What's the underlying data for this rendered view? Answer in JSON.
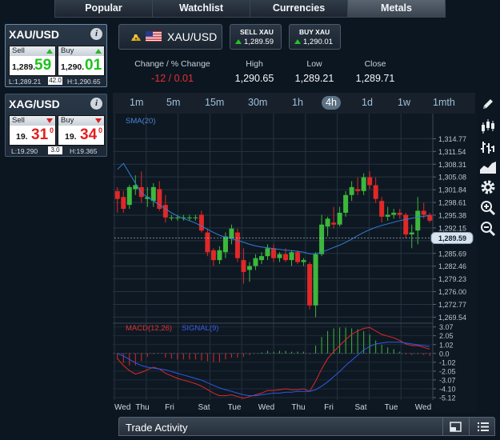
{
  "tabs": [
    "Popular",
    "Watchlist",
    "Currencies",
    "Metals"
  ],
  "active_tab": "Metals",
  "instruments": [
    {
      "name": "XAU/USD",
      "sell_label": "Sell",
      "buy_label": "Buy",
      "sell_small": "1,289.",
      "sell_big": "59",
      "sell_sup": "",
      "buy_small": "1,290.",
      "buy_big": "01",
      "buy_sup": "",
      "low": "L:1,289.21",
      "spread": "42.0",
      "high": "H:1,290.65",
      "direction": "up"
    },
    {
      "name": "XAG/USD",
      "sell_label": "Sell",
      "buy_label": "Buy",
      "sell_small": "19.",
      "sell_big": "31",
      "sell_sup": "0",
      "buy_small": "19.",
      "buy_big": "34",
      "buy_sup": "0",
      "low": "L:19.290",
      "spread": "3.0",
      "high": "H:19.365",
      "direction": "down"
    }
  ],
  "header": {
    "symbol": "XAU/USD",
    "sell_btn": {
      "title": "SELL XAU",
      "price": "1,289.59"
    },
    "buy_btn": {
      "title": "BUY XAU",
      "price": "1,290.01"
    },
    "stats": [
      {
        "label": "Change / % Change",
        "value": "-12 / 0.01",
        "color": "#e53030"
      },
      {
        "label": "High",
        "value": "1,290.65"
      },
      {
        "label": "Low",
        "value": "1,289.21"
      },
      {
        "label": "Close",
        "value": "1,289.71"
      }
    ]
  },
  "timeframes": [
    "1m",
    "5m",
    "15m",
    "30m",
    "1h",
    "4h",
    "1d",
    "1w",
    "1mth"
  ],
  "active_timeframe": "4h",
  "tools": [
    "pencil-icon",
    "candlestick-icon",
    "ohlc-bars-icon",
    "area-chart-icon",
    "settings-gear-icon",
    "zoom-in-icon",
    "zoom-out-icon"
  ],
  "trade_activity": {
    "title": "Trade Activity"
  },
  "chart_data": {
    "type": "candlestick",
    "indicator_label": "SMA(20)",
    "price_ticks": [
      "1,314.77",
      "1,311.54",
      "1,308.31",
      "1,305.08",
      "1,301.84",
      "1,298.61",
      "1,295.38",
      "1,292.15",
      "1,288.92",
      "1,285.69",
      "1,282.46",
      "1,279.23",
      "1,276.00",
      "1,272.77",
      "1,269.54"
    ],
    "price_range": [
      1268.0,
      1318.3
    ],
    "current_price": "1,289.59",
    "current_price_value": 1289.59,
    "x_labels": [
      "Wed",
      "Thu",
      "Fri",
      "Sat",
      "Tue",
      "Wed",
      "Thu",
      "Fri",
      "Sat",
      "Tue",
      "Wed"
    ],
    "candles": [
      [
        1301.5,
        1302.5,
        1296.0,
        1299.5
      ],
      [
        1300.0,
        1301.5,
        1296.0,
        1297.0
      ],
      [
        1298.0,
        1303.0,
        1297.0,
        1302.5
      ],
      [
        1302.0,
        1305.5,
        1300.5,
        1303.0
      ],
      [
        1302.5,
        1306.5,
        1298.5,
        1300.0
      ],
      [
        1299.5,
        1302.5,
        1297.5,
        1300.0
      ],
      [
        1299.0,
        1303.5,
        1297.5,
        1302.5
      ],
      [
        1302.0,
        1304.0,
        1296.5,
        1297.0
      ],
      [
        1298.0,
        1300.5,
        1293.5,
        1294.8
      ],
      [
        1294.8,
        1295.5,
        1294.0,
        1294.8
      ],
      [
        1294.8,
        1295.5,
        1294.0,
        1294.8
      ],
      [
        1294.8,
        1295.5,
        1294.0,
        1294.8
      ],
      [
        1294.8,
        1295.5,
        1294.0,
        1294.8
      ],
      [
        1294.8,
        1295.5,
        1294.0,
        1294.8
      ],
      [
        1295.5,
        1296.5,
        1291.0,
        1291.5
      ],
      [
        1291.0,
        1292.0,
        1285.0,
        1286.0
      ],
      [
        1286.5,
        1287.0,
        1282.5,
        1284.0
      ],
      [
        1284.0,
        1287.5,
        1283.0,
        1286.5
      ],
      [
        1286.0,
        1291.0,
        1284.5,
        1290.0
      ],
      [
        1289.5,
        1293.0,
        1288.0,
        1292.0
      ],
      [
        1291.0,
        1292.0,
        1283.5,
        1284.5
      ],
      [
        1284.0,
        1287.0,
        1278.0,
        1281.0
      ],
      [
        1281.5,
        1283.5,
        1278.5,
        1282.5
      ],
      [
        1282.5,
        1285.5,
        1281.5,
        1284.5
      ],
      [
        1284.0,
        1286.0,
        1283.0,
        1285.0
      ],
      [
        1285.0,
        1288.0,
        1284.0,
        1287.0
      ],
      [
        1287.0,
        1288.0,
        1283.5,
        1284.5
      ],
      [
        1284.5,
        1286.0,
        1283.5,
        1285.5
      ],
      [
        1285.5,
        1287.0,
        1283.5,
        1284.0
      ],
      [
        1284.0,
        1286.5,
        1282.5,
        1286.0
      ],
      [
        1286.0,
        1286.5,
        1283.0,
        1283.5
      ],
      [
        1283.5,
        1284.5,
        1282.5,
        1284.0
      ],
      [
        1283.0,
        1283.5,
        1271.5,
        1272.5
      ],
      [
        1272.5,
        1286.0,
        1269.5,
        1285.5
      ],
      [
        1285.5,
        1295.5,
        1285.0,
        1293.0
      ],
      [
        1292.5,
        1295.0,
        1290.0,
        1294.5
      ],
      [
        1293.5,
        1297.5,
        1292.0,
        1293.0
      ],
      [
        1293.0,
        1297.5,
        1292.5,
        1296.0
      ],
      [
        1296.0,
        1301.5,
        1295.0,
        1300.5
      ],
      [
        1300.5,
        1304.0,
        1299.0,
        1302.5
      ],
      [
        1302.0,
        1305.0,
        1300.5,
        1301.5
      ],
      [
        1301.5,
        1306.0,
        1300.5,
        1305.0
      ],
      [
        1305.0,
        1306.5,
        1302.0,
        1303.0
      ],
      [
        1303.0,
        1305.0,
        1298.5,
        1299.5
      ],
      [
        1299.0,
        1300.0,
        1293.5,
        1295.0
      ],
      [
        1295.0,
        1297.5,
        1294.0,
        1295.5
      ],
      [
        1295.5,
        1297.0,
        1294.5,
        1296.0
      ],
      [
        1296.0,
        1297.0,
        1294.5,
        1295.5
      ],
      [
        1295.5,
        1296.0,
        1289.5,
        1290.5
      ],
      [
        1290.5,
        1293.0,
        1287.0,
        1291.0
      ],
      [
        1291.5,
        1300.0,
        1288.0,
        1296.5
      ],
      [
        1296.5,
        1298.5,
        1294.5,
        1295.5
      ],
      [
        1295.5,
        1296.0,
        1293.5,
        1294.0
      ]
    ],
    "sma": [
      1307.0,
      1308.5,
      1306.0,
      1303.5,
      1301.0,
      1300.0,
      1299.0,
      1298.0,
      1297.0,
      1296.0,
      1295.2,
      1294.5,
      1294.0,
      1293.4,
      1292.6,
      1291.8,
      1291.0,
      1290.3,
      1289.8,
      1289.4,
      1289.0,
      1288.5,
      1288.0,
      1287.6,
      1287.3,
      1287.1,
      1286.9,
      1286.7,
      1286.5,
      1286.4,
      1286.2,
      1286.0,
      1285.6,
      1285.6,
      1286.0,
      1286.6,
      1287.2,
      1287.8,
      1288.5,
      1289.3,
      1290.2,
      1291.0,
      1291.7,
      1292.3,
      1292.8,
      1293.2,
      1293.6,
      1294.0,
      1294.3,
      1294.6,
      1294.9,
      1295.1,
      1295.3
    ],
    "macd": {
      "label": "MACD(12,26)",
      "signal_label": "SIGNAL(9)",
      "ticks": [
        "3.07",
        "2.05",
        "1.02",
        "0.0",
        "-1.02",
        "-2.05",
        "-3.07",
        "-4.10",
        "-5.12"
      ],
      "range": [
        -5.4,
        3.5
      ],
      "macd_line": [
        -0.6,
        -1.4,
        -2.0,
        -2.4,
        -2.2,
        -1.9,
        -1.6,
        -1.8,
        -2.3,
        -2.6,
        -2.9,
        -3.1,
        -3.3,
        -3.5,
        -3.8,
        -4.2,
        -4.6,
        -4.9,
        -4.9,
        -4.8,
        -5.0,
        -5.2,
        -5.0,
        -4.8,
        -4.6,
        -4.3,
        -4.3,
        -4.2,
        -4.1,
        -4.2,
        -4.2,
        -4.1,
        -4.4,
        -3.2,
        -1.8,
        -0.6,
        0.2,
        0.9,
        1.6,
        2.2,
        2.6,
        2.9,
        3.0,
        2.6,
        2.2,
        2.0,
        1.8,
        1.5,
        1.1,
        0.9,
        0.9,
        0.7,
        0.5
      ],
      "signal_line": [
        0.0,
        -0.3,
        -0.7,
        -1.1,
        -1.4,
        -1.6,
        -1.7,
        -1.8,
        -1.9,
        -2.1,
        -2.3,
        -2.5,
        -2.7,
        -2.9,
        -3.1,
        -3.4,
        -3.7,
        -4.0,
        -4.2,
        -4.4,
        -4.6,
        -4.8,
        -4.9,
        -4.9,
        -4.8,
        -4.7,
        -4.6,
        -4.6,
        -4.5,
        -4.5,
        -4.4,
        -4.4,
        -4.4,
        -4.2,
        -3.8,
        -3.3,
        -2.7,
        -2.1,
        -1.4,
        -0.8,
        -0.2,
        0.4,
        0.8,
        1.1,
        1.2,
        1.3,
        1.3,
        1.3,
        1.2,
        1.1,
        1.0,
        0.9,
        0.8
      ],
      "histogram": [
        -0.7,
        -1.1,
        -1.4,
        -1.4,
        -0.9,
        -0.4,
        -0.1,
        0.0,
        -0.5,
        -0.6,
        -0.7,
        -0.7,
        -0.7,
        -0.7,
        -0.8,
        -0.9,
        -1.0,
        -1.0,
        -0.7,
        -0.5,
        -0.5,
        -0.4,
        -0.2,
        0.0,
        0.1,
        0.3,
        0.2,
        0.3,
        0.3,
        0.2,
        0.2,
        0.2,
        -0.1,
        0.9,
        1.9,
        2.6,
        2.9,
        3.0,
        3.0,
        2.9,
        2.8,
        2.6,
        2.2,
        1.5,
        1.0,
        0.7,
        0.5,
        0.2,
        -0.1,
        -0.2,
        -0.1,
        -0.2,
        -0.3
      ]
    }
  }
}
